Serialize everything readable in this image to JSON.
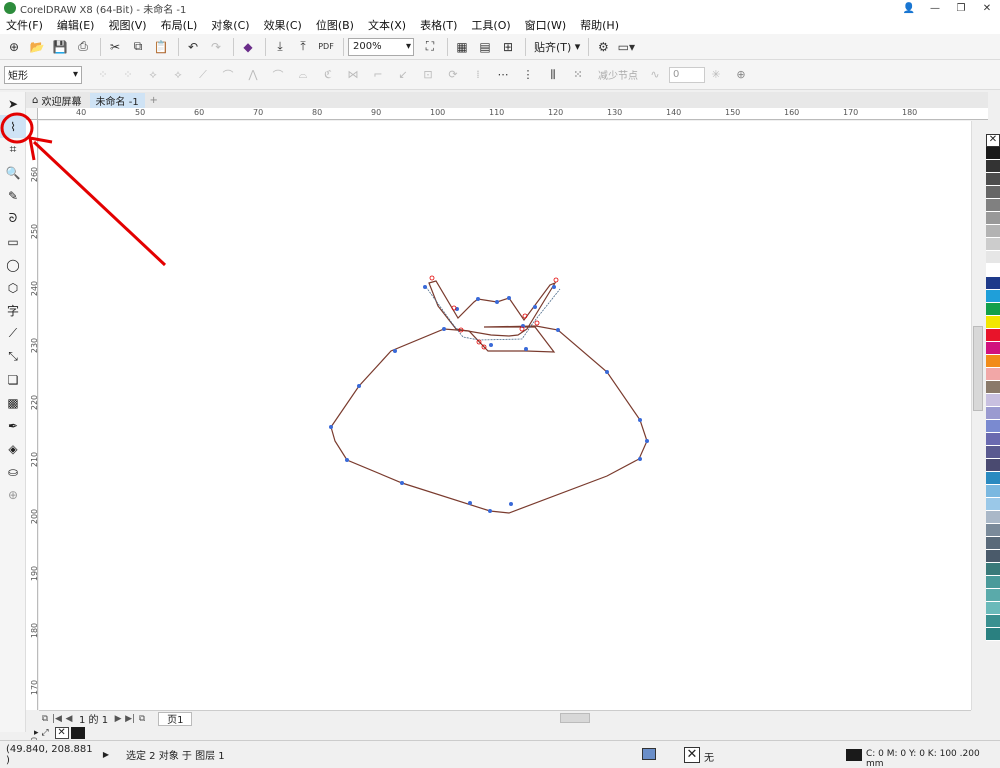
{
  "window": {
    "title": "CorelDRAW X8 (64-Bit) - 未命名 -1"
  },
  "menu": [
    "文件(F)",
    "编辑(E)",
    "视图(V)",
    "布局(L)",
    "对象(C)",
    "效果(C)",
    "位图(B)",
    "文本(X)",
    "表格(T)",
    "工具(O)",
    "窗口(W)",
    "帮助(H)"
  ],
  "toolbar": {
    "zoom": "200%",
    "snap_label": "贴齐(T)"
  },
  "propbar": {
    "shape_type": "矩形",
    "reduce_nodes": "减少节点",
    "smooth_value": "0"
  },
  "tabs": {
    "home": "欢迎屏幕",
    "doc": "未命名 -1",
    "add": "+"
  },
  "ruler_top": [
    "40",
    "50",
    "60",
    "70",
    "80",
    "90",
    "100",
    "110",
    "120",
    "130",
    "140",
    "150",
    "160",
    "170",
    "180"
  ],
  "ruler_left": [
    "260",
    "250",
    "240",
    "230",
    "220",
    "210",
    "200",
    "190",
    "180",
    "170",
    "160"
  ],
  "page_nav": {
    "page_info": "1 的 1",
    "page_tab": "页1"
  },
  "status": {
    "coords": "(49.840, 208.881 )",
    "selection": "选定 2 对象 于 图层 1",
    "fill_label": "无",
    "outline": "C: 0 M: 0 Y: 0 K: 100  .200 mm"
  },
  "palette_colors": [
    "#1a1a1a",
    "#333333",
    "#4d4d4d",
    "#666666",
    "#808080",
    "#999999",
    "#b3b3b3",
    "#cccccc",
    "#e6e6e6",
    "#ffffff",
    "#1e3a8a",
    "#1f9fd9",
    "#12a04a",
    "#f2e600",
    "#e8142a",
    "#d1127e",
    "#f28c1a",
    "#f2a7a7",
    "#8a7a6a",
    "#c8c0e0",
    "#9a9ad0",
    "#7a8ad0",
    "#6a6ab0",
    "#5a5a90",
    "#4a4a70",
    "#2a8ac0",
    "#7ab8e0",
    "#9ac8e8",
    "#aab8c8",
    "#7a8a9a",
    "#5a6a7a",
    "#4a5a6a",
    "#3a7a7a",
    "#4a9a9a",
    "#5aaaaa",
    "#6ababa",
    "#3a9090",
    "#2a8080"
  ],
  "colors": {
    "accent_red": "#e30000",
    "outline_brown": "#7a3b2e",
    "node_blue": "#3a6ad8"
  }
}
